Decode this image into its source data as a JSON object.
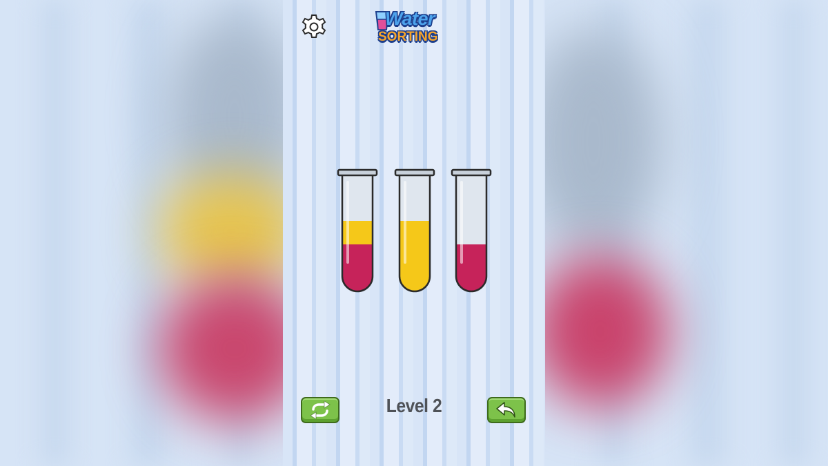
{
  "game": {
    "title_line1": "Water",
    "title_line2": "SORTING",
    "level_label": "Level 2"
  },
  "tubes": [
    {
      "id": 1,
      "layers_bottom_to_top": [
        "red",
        "yellow"
      ]
    },
    {
      "id": 2,
      "layers_bottom_to_top": [
        "yellow",
        "yellow"
      ]
    },
    {
      "id": 3,
      "layers_bottom_to_top": [
        "red"
      ]
    }
  ],
  "colors": {
    "red": "#c6235a",
    "yellow": "#f5c819",
    "button_green": "#7dc24a",
    "glass": "#dfe6ee"
  },
  "icons": {
    "settings": "gear-icon",
    "restart": "restart-icon",
    "undo": "undo-icon"
  }
}
